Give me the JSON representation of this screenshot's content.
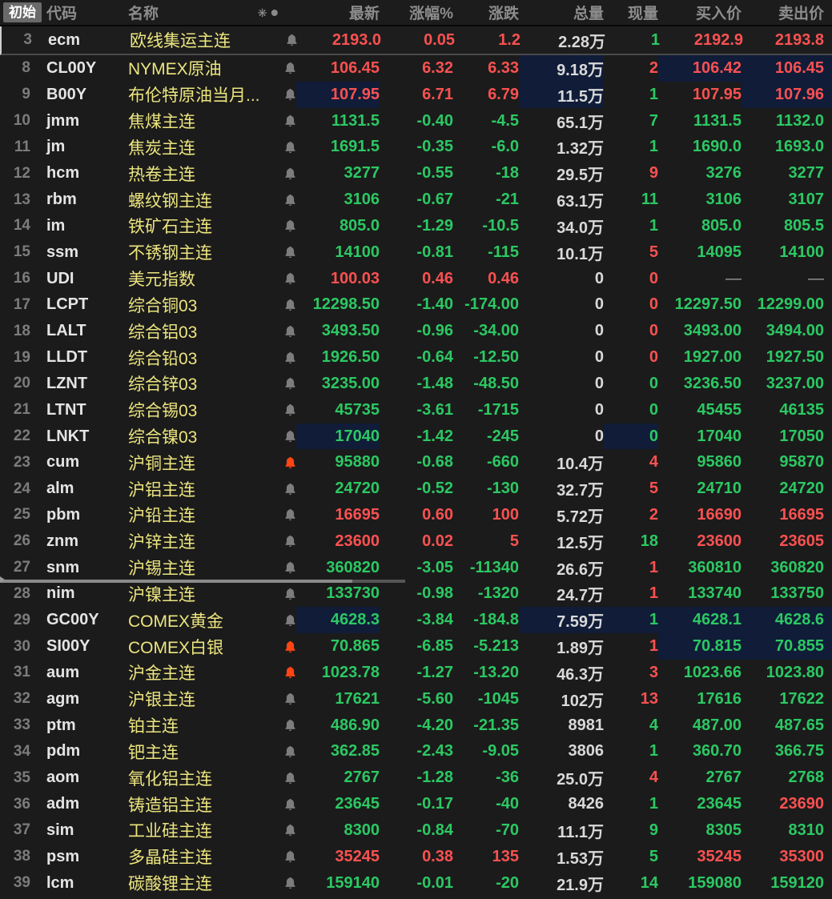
{
  "header": {
    "tab": "初始",
    "columns": [
      "代码",
      "名称",
      "最新",
      "涨幅%",
      "涨跌",
      "总量",
      "现量",
      "买入价",
      "卖出价"
    ]
  },
  "colors": {
    "up": "#fa5151",
    "down": "#2cc863",
    "neutral": "#d9d9d9",
    "name_yellow": "#ece57f",
    "flash_highlight": "#101c38",
    "bell_gray": "#7d7d7d",
    "bell_alert": "#ff4514"
  },
  "rows": [
    {
      "n": "3",
      "code": "ecm",
      "name": "欧线集运主连",
      "bell": "gray",
      "last": "2193.0",
      "pct": "0.05",
      "chg": "1.2",
      "vol": "2.28万",
      "cur": "1",
      "bid": "2192.9",
      "ask": "2193.8",
      "dir": "r",
      "curC": "g",
      "bidC": "r",
      "askC": "r",
      "pinned": true
    },
    {
      "n": "8",
      "code": "CL00Y",
      "name": "NYMEX原油",
      "bell": "gray",
      "last": "106.45",
      "pct": "6.32",
      "chg": "6.33",
      "vol": "9.18万",
      "cur": "2",
      "bid": "106.42",
      "ask": "106.45",
      "dir": "r",
      "curC": "r",
      "bidC": "r",
      "askC": "r",
      "hl": [
        "vol",
        "bid",
        "ask"
      ]
    },
    {
      "n": "9",
      "code": "B00Y",
      "name": "布伦特原油当月...",
      "bell": "gray",
      "last": "107.95",
      "pct": "6.71",
      "chg": "6.79",
      "vol": "11.5万",
      "cur": "1",
      "bid": "107.95",
      "ask": "107.96",
      "dir": "r",
      "curC": "g",
      "bidC": "r",
      "askC": "r",
      "hl": [
        "last",
        "vol",
        "ask"
      ]
    },
    {
      "n": "10",
      "code": "jmm",
      "name": "焦煤主连",
      "bell": "gray",
      "last": "1131.5",
      "pct": "-0.40",
      "chg": "-4.5",
      "vol": "65.1万",
      "cur": "7",
      "bid": "1131.5",
      "ask": "1132.0",
      "dir": "g",
      "curC": "g",
      "bidC": "g",
      "askC": "g"
    },
    {
      "n": "11",
      "code": "jm",
      "name": "焦炭主连",
      "bell": "gray",
      "last": "1691.5",
      "pct": "-0.35",
      "chg": "-6.0",
      "vol": "1.32万",
      "cur": "1",
      "bid": "1690.0",
      "ask": "1693.0",
      "dir": "g",
      "curC": "g",
      "bidC": "g",
      "askC": "g"
    },
    {
      "n": "12",
      "code": "hcm",
      "name": "热卷主连",
      "bell": "gray",
      "last": "3277",
      "pct": "-0.55",
      "chg": "-18",
      "vol": "29.5万",
      "cur": "9",
      "bid": "3276",
      "ask": "3277",
      "dir": "g",
      "curC": "r",
      "bidC": "g",
      "askC": "g"
    },
    {
      "n": "13",
      "code": "rbm",
      "name": "螺纹钢主连",
      "bell": "gray",
      "last": "3106",
      "pct": "-0.67",
      "chg": "-21",
      "vol": "63.1万",
      "cur": "11",
      "bid": "3106",
      "ask": "3107",
      "dir": "g",
      "curC": "g",
      "bidC": "g",
      "askC": "g"
    },
    {
      "n": "14",
      "code": "im",
      "name": "铁矿石主连",
      "bell": "gray",
      "last": "805.0",
      "pct": "-1.29",
      "chg": "-10.5",
      "vol": "34.0万",
      "cur": "1",
      "bid": "805.0",
      "ask": "805.5",
      "dir": "g",
      "curC": "g",
      "bidC": "g",
      "askC": "g"
    },
    {
      "n": "15",
      "code": "ssm",
      "name": "不锈钢主连",
      "bell": "gray",
      "last": "14100",
      "pct": "-0.81",
      "chg": "-115",
      "vol": "10.1万",
      "cur": "5",
      "bid": "14095",
      "ask": "14100",
      "dir": "g",
      "curC": "r",
      "bidC": "g",
      "askC": "g"
    },
    {
      "n": "16",
      "code": "UDI",
      "name": "美元指数",
      "bell": "gray",
      "last": "100.03",
      "pct": "0.46",
      "chg": "0.46",
      "vol": "0",
      "cur": "0",
      "bid": "—",
      "ask": "—",
      "dir": "r",
      "curC": "r",
      "bidC": "d",
      "askC": "d"
    },
    {
      "n": "17",
      "code": "LCPT",
      "name": "综合铜03",
      "bell": "gray",
      "last": "12298.50",
      "pct": "-1.40",
      "chg": "-174.00",
      "vol": "0",
      "cur": "0",
      "bid": "12297.50",
      "ask": "12299.00",
      "dir": "g",
      "curC": "r",
      "bidC": "g",
      "askC": "g"
    },
    {
      "n": "18",
      "code": "LALT",
      "name": "综合铝03",
      "bell": "gray",
      "last": "3493.50",
      "pct": "-0.96",
      "chg": "-34.00",
      "vol": "0",
      "cur": "0",
      "bid": "3493.00",
      "ask": "3494.00",
      "dir": "g",
      "curC": "r",
      "bidC": "g",
      "askC": "g"
    },
    {
      "n": "19",
      "code": "LLDT",
      "name": "综合铅03",
      "bell": "gray",
      "last": "1926.50",
      "pct": "-0.64",
      "chg": "-12.50",
      "vol": "0",
      "cur": "0",
      "bid": "1927.00",
      "ask": "1927.50",
      "dir": "g",
      "curC": "r",
      "bidC": "g",
      "askC": "g"
    },
    {
      "n": "20",
      "code": "LZNT",
      "name": "综合锌03",
      "bell": "gray",
      "last": "3235.00",
      "pct": "-1.48",
      "chg": "-48.50",
      "vol": "0",
      "cur": "0",
      "bid": "3236.50",
      "ask": "3237.00",
      "dir": "g",
      "curC": "g",
      "bidC": "g",
      "askC": "g"
    },
    {
      "n": "21",
      "code": "LTNT",
      "name": "综合锡03",
      "bell": "gray",
      "last": "45735",
      "pct": "-3.61",
      "chg": "-1715",
      "vol": "0",
      "cur": "0",
      "bid": "45455",
      "ask": "46135",
      "dir": "g",
      "curC": "g",
      "bidC": "g",
      "askC": "g"
    },
    {
      "n": "22",
      "code": "LNKT",
      "name": "综合镍03",
      "bell": "gray",
      "last": "17040",
      "pct": "-1.42",
      "chg": "-245",
      "vol": "0",
      "cur": "0",
      "bid": "17040",
      "ask": "17050",
      "dir": "g",
      "curC": "g",
      "bidC": "g",
      "askC": "g",
      "hl": [
        "last",
        "cur"
      ]
    },
    {
      "n": "23",
      "code": "cum",
      "name": "沪铜主连",
      "bell": "red",
      "last": "95880",
      "pct": "-0.68",
      "chg": "-660",
      "vol": "10.4万",
      "cur": "4",
      "bid": "95860",
      "ask": "95870",
      "dir": "g",
      "curC": "r",
      "bidC": "g",
      "askC": "g"
    },
    {
      "n": "24",
      "code": "alm",
      "name": "沪铝主连",
      "bell": "gray",
      "last": "24720",
      "pct": "-0.52",
      "chg": "-130",
      "vol": "32.7万",
      "cur": "5",
      "bid": "24710",
      "ask": "24720",
      "dir": "g",
      "curC": "r",
      "bidC": "g",
      "askC": "g"
    },
    {
      "n": "25",
      "code": "pbm",
      "name": "沪铅主连",
      "bell": "gray",
      "last": "16695",
      "pct": "0.60",
      "chg": "100",
      "vol": "5.72万",
      "cur": "2",
      "bid": "16690",
      "ask": "16695",
      "dir": "r",
      "curC": "r",
      "bidC": "r",
      "askC": "r"
    },
    {
      "n": "26",
      "code": "znm",
      "name": "沪锌主连",
      "bell": "gray",
      "last": "23600",
      "pct": "0.02",
      "chg": "5",
      "vol": "12.5万",
      "cur": "18",
      "bid": "23600",
      "ask": "23605",
      "dir": "r",
      "curC": "g",
      "bidC": "r",
      "askC": "r"
    },
    {
      "n": "27",
      "code": "snm",
      "name": "沪锡主连",
      "bell": "gray",
      "last": "360820",
      "pct": "-3.05",
      "chg": "-11340",
      "vol": "26.6万",
      "cur": "1",
      "bid": "360810",
      "ask": "360820",
      "dir": "g",
      "curC": "r",
      "bidC": "g",
      "askC": "g",
      "splitter": true
    },
    {
      "n": "28",
      "code": "nim",
      "name": "沪镍主连",
      "bell": "gray",
      "last": "133730",
      "pct": "-0.98",
      "chg": "-1320",
      "vol": "24.7万",
      "cur": "1",
      "bid": "133740",
      "ask": "133750",
      "dir": "g",
      "curC": "r",
      "bidC": "g",
      "askC": "g"
    },
    {
      "n": "29",
      "code": "GC00Y",
      "name": "COMEX黄金",
      "bell": "gray",
      "last": "4628.3",
      "pct": "-3.84",
      "chg": "-184.8",
      "vol": "7.59万",
      "cur": "1",
      "bid": "4628.1",
      "ask": "4628.6",
      "dir": "g",
      "curC": "g",
      "bidC": "g",
      "askC": "g",
      "hl": [
        "last",
        "vol",
        "cur",
        "bid",
        "ask"
      ]
    },
    {
      "n": "30",
      "code": "SI00Y",
      "name": "COMEX白银",
      "bell": "red",
      "last": "70.865",
      "pct": "-6.85",
      "chg": "-5.213",
      "vol": "1.89万",
      "cur": "1",
      "bid": "70.815",
      "ask": "70.855",
      "dir": "g",
      "curC": "r",
      "bidC": "g",
      "askC": "g",
      "hl": [
        "bid",
        "ask"
      ]
    },
    {
      "n": "31",
      "code": "aum",
      "name": "沪金主连",
      "bell": "red",
      "last": "1023.78",
      "pct": "-1.27",
      "chg": "-13.20",
      "vol": "46.3万",
      "cur": "3",
      "bid": "1023.66",
      "ask": "1023.80",
      "dir": "g",
      "curC": "r",
      "bidC": "g",
      "askC": "g"
    },
    {
      "n": "32",
      "code": "agm",
      "name": "沪银主连",
      "bell": "gray",
      "last": "17621",
      "pct": "-5.60",
      "chg": "-1045",
      "vol": "102万",
      "cur": "13",
      "bid": "17616",
      "ask": "17622",
      "dir": "g",
      "curC": "r",
      "bidC": "g",
      "askC": "g"
    },
    {
      "n": "33",
      "code": "ptm",
      "name": "铂主连",
      "bell": "gray",
      "last": "486.90",
      "pct": "-4.20",
      "chg": "-21.35",
      "vol": "8981",
      "cur": "4",
      "bid": "487.00",
      "ask": "487.65",
      "dir": "g",
      "curC": "g",
      "bidC": "g",
      "askC": "g"
    },
    {
      "n": "34",
      "code": "pdm",
      "name": "钯主连",
      "bell": "gray",
      "last": "362.85",
      "pct": "-2.43",
      "chg": "-9.05",
      "vol": "3806",
      "cur": "1",
      "bid": "360.70",
      "ask": "366.75",
      "dir": "g",
      "curC": "g",
      "bidC": "g",
      "askC": "g"
    },
    {
      "n": "35",
      "code": "aom",
      "name": "氧化铝主连",
      "bell": "gray",
      "last": "2767",
      "pct": "-1.28",
      "chg": "-36",
      "vol": "25.0万",
      "cur": "4",
      "bid": "2767",
      "ask": "2768",
      "dir": "g",
      "curC": "r",
      "bidC": "g",
      "askC": "g"
    },
    {
      "n": "36",
      "code": "adm",
      "name": "铸造铝主连",
      "bell": "gray",
      "last": "23645",
      "pct": "-0.17",
      "chg": "-40",
      "vol": "8426",
      "cur": "1",
      "bid": "23645",
      "ask": "23690",
      "dir": "g",
      "curC": "g",
      "bidC": "g",
      "askC": "r"
    },
    {
      "n": "37",
      "code": "sim",
      "name": "工业硅主连",
      "bell": "gray",
      "last": "8300",
      "pct": "-0.84",
      "chg": "-70",
      "vol": "11.1万",
      "cur": "9",
      "bid": "8305",
      "ask": "8310",
      "dir": "g",
      "curC": "g",
      "bidC": "g",
      "askC": "g"
    },
    {
      "n": "38",
      "code": "psm",
      "name": "多晶硅主连",
      "bell": "gray",
      "last": "35245",
      "pct": "0.38",
      "chg": "135",
      "vol": "1.53万",
      "cur": "5",
      "bid": "35245",
      "ask": "35300",
      "dir": "r",
      "curC": "g",
      "bidC": "r",
      "askC": "r"
    },
    {
      "n": "39",
      "code": "lcm",
      "name": "碳酸锂主连",
      "bell": "gray",
      "last": "159140",
      "pct": "-0.01",
      "chg": "-20",
      "vol": "21.9万",
      "cur": "14",
      "bid": "159080",
      "ask": "159120",
      "dir": "g",
      "curC": "g",
      "bidC": "g",
      "askC": "g"
    }
  ]
}
